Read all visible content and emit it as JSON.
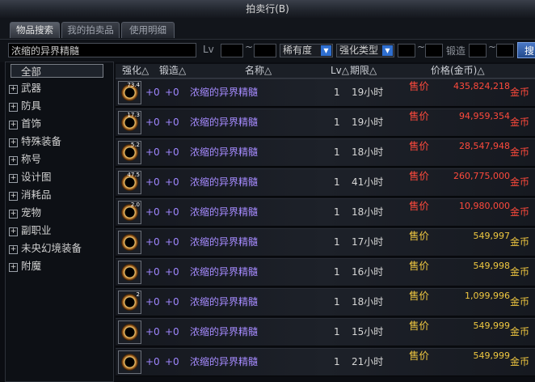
{
  "window": {
    "title": "拍卖行(B)"
  },
  "tabs": [
    {
      "label": "物品搜索",
      "active": true
    },
    {
      "label": "我的拍卖品",
      "active": false
    },
    {
      "label": "使用明细",
      "active": false
    }
  ],
  "filter": {
    "search_value": "浓缩的异界精髓",
    "lv_label": "Lv",
    "tilde": "~",
    "rarity_label": "稀有度",
    "enhance_label": "强化类型",
    "forge_label": "锻造",
    "search_button": "搜"
  },
  "sidebar": {
    "items": [
      {
        "label": "全部",
        "selected": true
      },
      {
        "label": "武器"
      },
      {
        "label": "防具"
      },
      {
        "label": "首饰"
      },
      {
        "label": "特殊装备"
      },
      {
        "label": "称号"
      },
      {
        "label": "设计图"
      },
      {
        "label": "消耗品"
      },
      {
        "label": "宠物"
      },
      {
        "label": "副职业"
      },
      {
        "label": "未央幻境装备"
      },
      {
        "label": "附魔"
      }
    ]
  },
  "columns": {
    "enhance": "强化△",
    "forge": "锻造△",
    "name": "名称△",
    "lv": "Lv△",
    "duration": "期限△",
    "price": "价格(金币)△"
  },
  "colors": {
    "sell_red": "#ff4a3c",
    "sell_gold": "#f0c840",
    "item_purple": "#a68bff"
  },
  "rows": [
    {
      "icon_badge": "73.4",
      "enhance": "+0",
      "forge": "+0",
      "name": "浓缩的异界精髓",
      "qty": "1",
      "duration": "19小时",
      "sell_type": "售价",
      "price": "435,824,218",
      "currency": "金币",
      "tone": "red"
    },
    {
      "icon_badge": "17.3",
      "enhance": "+0",
      "forge": "+0",
      "name": "浓缩的异界精髓",
      "qty": "1",
      "duration": "19小时",
      "sell_type": "售价",
      "price": "94,959,354",
      "currency": "金币",
      "tone": "red"
    },
    {
      "icon_badge": "5.2",
      "enhance": "+0",
      "forge": "+0",
      "name": "浓缩的异界精髓",
      "qty": "1",
      "duration": "18小时",
      "sell_type": "售价",
      "price": "28,547,948",
      "currency": "金币",
      "tone": "red"
    },
    {
      "icon_badge": "47.5",
      "enhance": "+0",
      "forge": "+0",
      "name": "浓缩的异界精髓",
      "qty": "1",
      "duration": "41小时",
      "sell_type": "售价",
      "price": "260,775,000",
      "currency": "金币",
      "tone": "red"
    },
    {
      "icon_badge": "2.0",
      "enhance": "+0",
      "forge": "+0",
      "name": "浓缩的异界精髓",
      "qty": "1",
      "duration": "18小时",
      "sell_type": "售价",
      "price": "10,980,000",
      "currency": "金币",
      "tone": "red"
    },
    {
      "icon_badge": "",
      "enhance": "+0",
      "forge": "+0",
      "name": "浓缩的异界精髓",
      "qty": "1",
      "duration": "17小时",
      "sell_type": "售价",
      "price": "549,997",
      "currency": "金币",
      "tone": "gold"
    },
    {
      "icon_badge": "",
      "enhance": "+0",
      "forge": "+0",
      "name": "浓缩的异界精髓",
      "qty": "1",
      "duration": "16小时",
      "sell_type": "售价",
      "price": "549,998",
      "currency": "金币",
      "tone": "gold"
    },
    {
      "icon_badge": "2",
      "enhance": "+0",
      "forge": "+0",
      "name": "浓缩的异界精髓",
      "qty": "1",
      "duration": "18小时",
      "sell_type": "售价",
      "price": "1,099,996",
      "currency": "金币",
      "tone": "gold"
    },
    {
      "icon_badge": "",
      "enhance": "+0",
      "forge": "+0",
      "name": "浓缩的异界精髓",
      "qty": "1",
      "duration": "15小时",
      "sell_type": "售价",
      "price": "549,999",
      "currency": "金币",
      "tone": "gold"
    },
    {
      "icon_badge": "",
      "enhance": "+0",
      "forge": "+0",
      "name": "浓缩的异界精髓",
      "qty": "1",
      "duration": "21小时",
      "sell_type": "售价",
      "price": "549,999",
      "currency": "金币",
      "tone": "gold"
    }
  ]
}
